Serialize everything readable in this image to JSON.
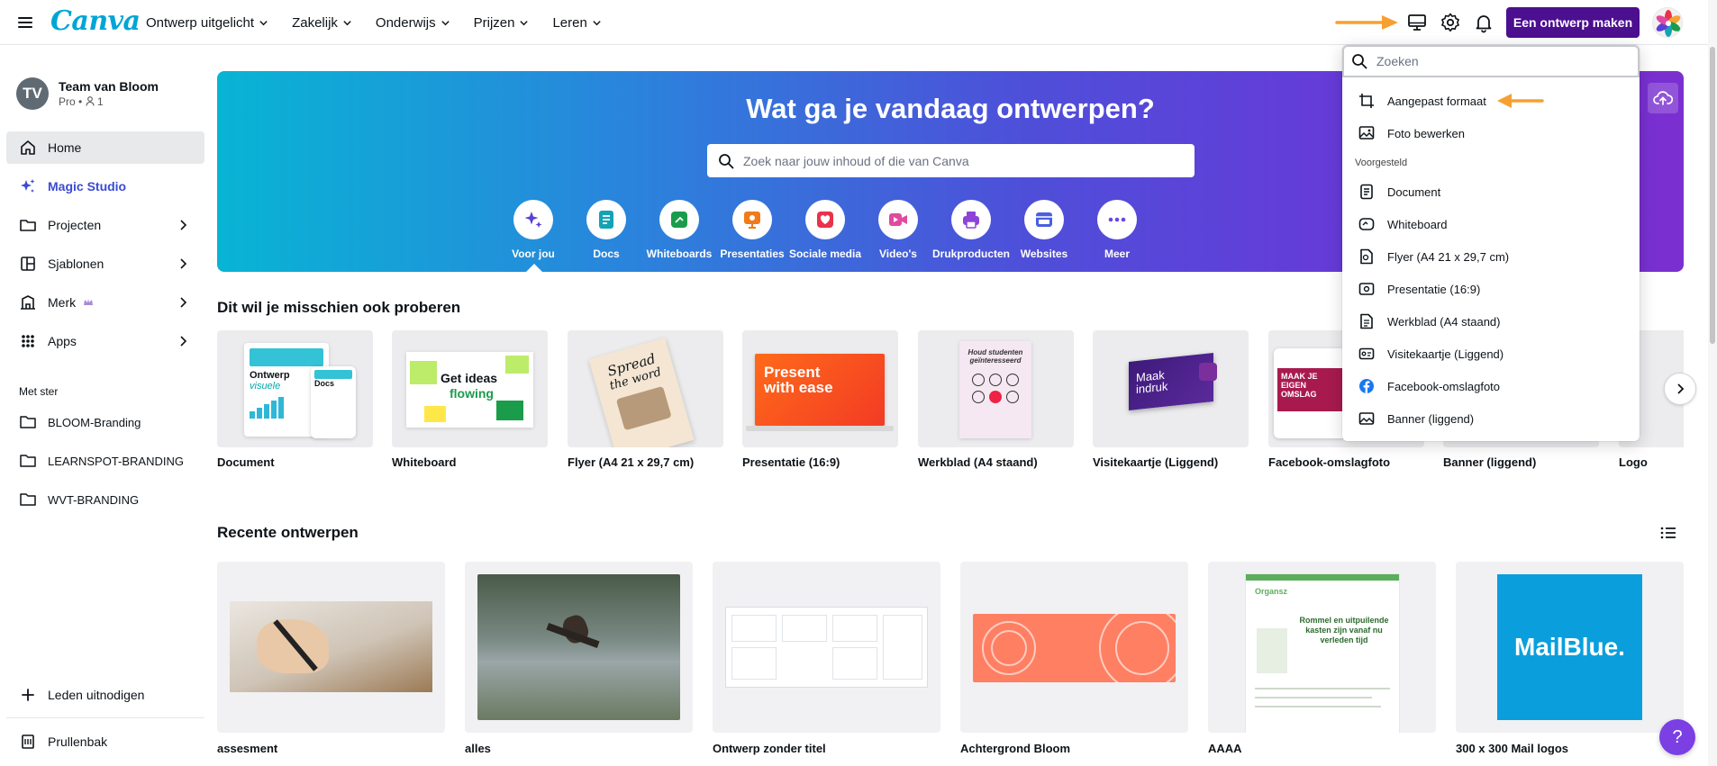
{
  "app": {
    "logo_text": "Canva",
    "create_button": "Een ontwerp maken"
  },
  "nav": [
    {
      "label": "Ontwerp uitgelicht"
    },
    {
      "label": "Zakelijk"
    },
    {
      "label": "Onderwijs"
    },
    {
      "label": "Prijzen"
    },
    {
      "label": "Leren"
    }
  ],
  "icons": {
    "menu": "hamburger-icon",
    "desktop": "desktop-icon",
    "settings": "gear-icon",
    "notifications": "bell-icon",
    "accent_color": "#4b0f8f",
    "arrow_color": "#f7a031"
  },
  "team": {
    "initials": "TV",
    "name": "Team van Bloom",
    "plan": "Pro • ",
    "members": "1"
  },
  "sidebar": {
    "items": [
      {
        "label": "Home"
      },
      {
        "label": "Magic Studio"
      },
      {
        "label": "Projecten"
      },
      {
        "label": "Sjablonen"
      },
      {
        "label": "Merk"
      },
      {
        "label": "Apps"
      }
    ],
    "starred_label": "Met ster",
    "starred": [
      {
        "label": "BLOOM-Branding"
      },
      {
        "label": "LEARNSPOT-BRANDING"
      },
      {
        "label": "WVT-BRANDING"
      }
    ],
    "invite": "Leden uitnodigen",
    "trash": "Prullenbak"
  },
  "hero": {
    "title": "Wat ga je vandaag ontwerpen?",
    "search_placeholder": "Zoek naar jouw inhoud of die van Canva",
    "categories": [
      {
        "label": "Voor jou",
        "color": "#5b3fd8"
      },
      {
        "label": "Docs",
        "color": "#13a3b5"
      },
      {
        "label": "Whiteboards",
        "color": "#1a9c4a"
      },
      {
        "label": "Presentaties",
        "color": "#f07b1a"
      },
      {
        "label": "Sociale media",
        "color": "#e8334a"
      },
      {
        "label": "Video's",
        "color": "#e04ba0"
      },
      {
        "label": "Drukproducten",
        "color": "#8e44d8"
      },
      {
        "label": "Websites",
        "color": "#4a5fe0"
      },
      {
        "label": "Meer",
        "color": "#6b47dc"
      }
    ]
  },
  "suggestions": {
    "title": "Dit wil je misschien ook proberen",
    "items": [
      {
        "label": "Document",
        "thumb_line1": "Ontwerp",
        "thumb_line2": "visuele",
        "thumb_line3": "Docs"
      },
      {
        "label": "Whiteboard",
        "thumb_line1": "Get ideas",
        "thumb_line2": "flowing"
      },
      {
        "label": "Flyer (A4 21 x 29,7 cm)",
        "thumb_line1": "Spread",
        "thumb_line2": "the word"
      },
      {
        "label": "Presentatie (16:9)",
        "thumb_line1": "Present",
        "thumb_line2": "with ease"
      },
      {
        "label": "Werkblad (A4 staand)",
        "thumb_line1": "Houd studenten",
        "thumb_line2": "geïnteresseerd"
      },
      {
        "label": "Visitekaartje (Liggend)",
        "thumb_line1": "Maak",
        "thumb_line2": "indruk"
      },
      {
        "label": "Facebook-omslagfoto",
        "thumb_line1": "MAAK JE",
        "thumb_line2": "EIGEN",
        "thumb_line3": "OMSLAG"
      },
      {
        "label": "Banner (liggend)"
      },
      {
        "label": "Logo"
      }
    ]
  },
  "recent": {
    "title": "Recente ontwerpen",
    "items": [
      {
        "label": "assesment"
      },
      {
        "label": "alles"
      },
      {
        "label": "Ontwerp zonder titel"
      },
      {
        "label": "Achtergrond Bloom"
      },
      {
        "label": "AAAA",
        "thumb_text1": "Rommel en uitpuilende",
        "thumb_text2": "kasten zijn vanaf nu",
        "thumb_text3": "verleden tijd",
        "thumb_text4": "Organsz"
      },
      {
        "label": "300 x 300 Mail logos",
        "thumb_text1": "MailBlue."
      }
    ]
  },
  "dropdown": {
    "search_placeholder": "Zoeken",
    "top_items": [
      {
        "label": "Aangepast formaat"
      },
      {
        "label": "Foto bewerken"
      }
    ],
    "section_label": "Voorgesteld",
    "items": [
      {
        "label": "Document"
      },
      {
        "label": "Whiteboard"
      },
      {
        "label": "Flyer (A4 21 x 29,7 cm)"
      },
      {
        "label": "Presentatie (16:9)"
      },
      {
        "label": "Werkblad (A4 staand)"
      },
      {
        "label": "Visitekaartje (Liggend)"
      },
      {
        "label": "Facebook-omslagfoto"
      },
      {
        "label": "Banner (liggend)"
      }
    ]
  },
  "help": {
    "label": "?"
  }
}
